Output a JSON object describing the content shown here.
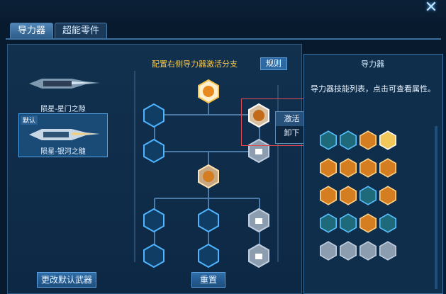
{
  "window": {
    "close_label": "✕"
  },
  "tabs": [
    {
      "label": "导力器",
      "active": true
    },
    {
      "label": "超能零件",
      "active": false
    }
  ],
  "weapons": [
    {
      "name": "陨星-星门之隙",
      "selected": false,
      "default": false
    },
    {
      "name": "陨星-银河之髓",
      "selected": true,
      "default": true,
      "default_label": "默认"
    }
  ],
  "config": {
    "title": "配置右侧导力器激活分支",
    "rule_label": "规则"
  },
  "context_menu": {
    "items": [
      "激活",
      "卸下"
    ]
  },
  "buttons": {
    "change_default_label": "更改默认武器",
    "reset_label": "重置"
  },
  "right_panel": {
    "title": "导力器",
    "description": "导力器技能列表，点击可查看属性。",
    "skills": [
      "check",
      "check",
      "orange",
      "orange-active",
      "",
      "orange",
      "orange",
      "orange",
      "orange",
      "",
      "orange",
      "orange",
      "check",
      "orange",
      "",
      "check",
      "check",
      "orange",
      "check",
      "",
      "lock",
      "lock",
      "lock",
      "lock",
      ""
    ]
  },
  "colors": {
    "accent": "#f6c64a",
    "panel": "#0f2e4c",
    "highlight": "#e0484f"
  }
}
